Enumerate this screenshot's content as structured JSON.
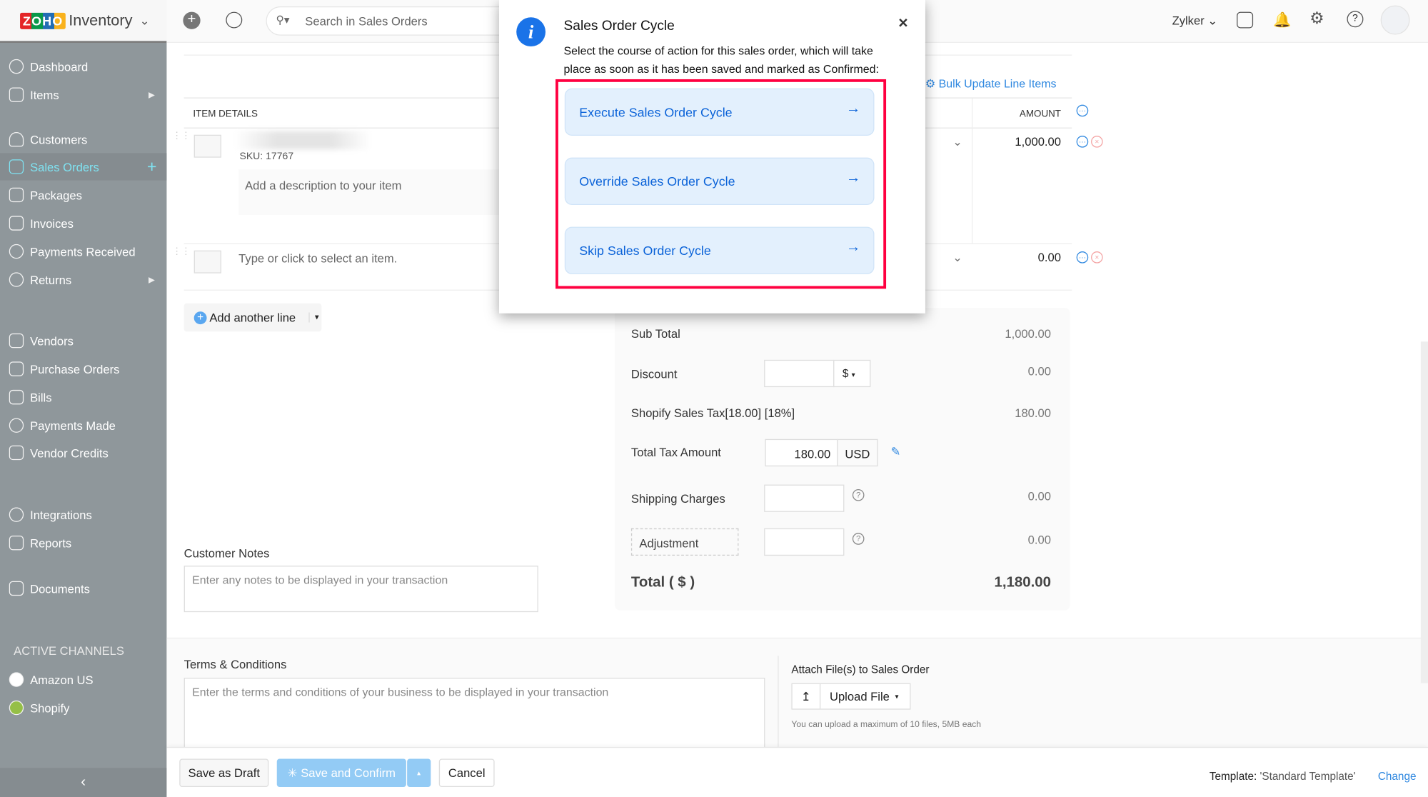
{
  "app": {
    "logo_text": "ZOHO",
    "name": "Inventory"
  },
  "search": {
    "placeholder": "Search in Sales Orders"
  },
  "header": {
    "org": "Zylker"
  },
  "sidebar": {
    "items": [
      {
        "label": "Dashboard"
      },
      {
        "label": "Items"
      },
      {
        "label": "Customers"
      },
      {
        "label": "Sales Orders"
      },
      {
        "label": "Packages"
      },
      {
        "label": "Invoices"
      },
      {
        "label": "Payments Received"
      },
      {
        "label": "Returns"
      },
      {
        "label": "Vendors"
      },
      {
        "label": "Purchase Orders"
      },
      {
        "label": "Bills"
      },
      {
        "label": "Payments Made"
      },
      {
        "label": "Vendor Credits"
      },
      {
        "label": "Integrations"
      },
      {
        "label": "Reports"
      },
      {
        "label": "Documents"
      }
    ],
    "channels_heading": "ACTIVE CHANNELS",
    "channels": [
      {
        "label": "Amazon US"
      },
      {
        "label": "Shopify"
      }
    ]
  },
  "items_table": {
    "bulk_update": "Bulk Update Line Items",
    "col_item": "ITEM DETAILS",
    "col_amount": "AMOUNT",
    "rows": [
      {
        "sku": "SKU: 17767",
        "description_placeholder": "Add a description to your item",
        "amount": "1,000.00"
      },
      {
        "placeholder": "Type or click to select an item.",
        "amount": "0.00"
      }
    ],
    "add_line": "Add another line"
  },
  "totals": {
    "sub_total_label": "Sub Total",
    "sub_total": "1,000.00",
    "discount_label": "Discount",
    "discount_unit": "$",
    "discount": "0.00",
    "tax_label": "Shopify Sales Tax[18.00] [18%]",
    "tax": "180.00",
    "total_tax_label": "Total Tax Amount",
    "total_tax_input": "180.00",
    "currency": "USD",
    "shipping_label": "Shipping Charges",
    "shipping": "0.00",
    "adjustment_label": "Adjustment",
    "adjustment": "0.00",
    "total_label": "Total ( $ )",
    "total": "1,180.00"
  },
  "notes": {
    "label": "Customer Notes",
    "placeholder": "Enter any notes to be displayed in your transaction"
  },
  "terms": {
    "label": "Terms & Conditions",
    "placeholder": "Enter the terms and conditions of your business to be displayed in your transaction"
  },
  "attach": {
    "label": "Attach File(s) to Sales Order",
    "button": "Upload File",
    "hint": "You can upload a maximum of 10 files, 5MB each"
  },
  "footer": {
    "save_draft": "Save as Draft",
    "save_confirm": "Save and Confirm",
    "cancel": "Cancel",
    "template_label": "Template:",
    "template_value": "'Standard Template'",
    "change": "Change"
  },
  "modal": {
    "title": "Sales Order Cycle",
    "body": "Select the course of action for this sales order, which will take place as soon as it has been saved and marked as Confirmed:",
    "options": [
      {
        "label": "Execute Sales Order Cycle"
      },
      {
        "label": "Override Sales Order Cycle"
      },
      {
        "label": "Skip Sales Order Cycle"
      }
    ],
    "highlight_color": "#ff0040"
  }
}
